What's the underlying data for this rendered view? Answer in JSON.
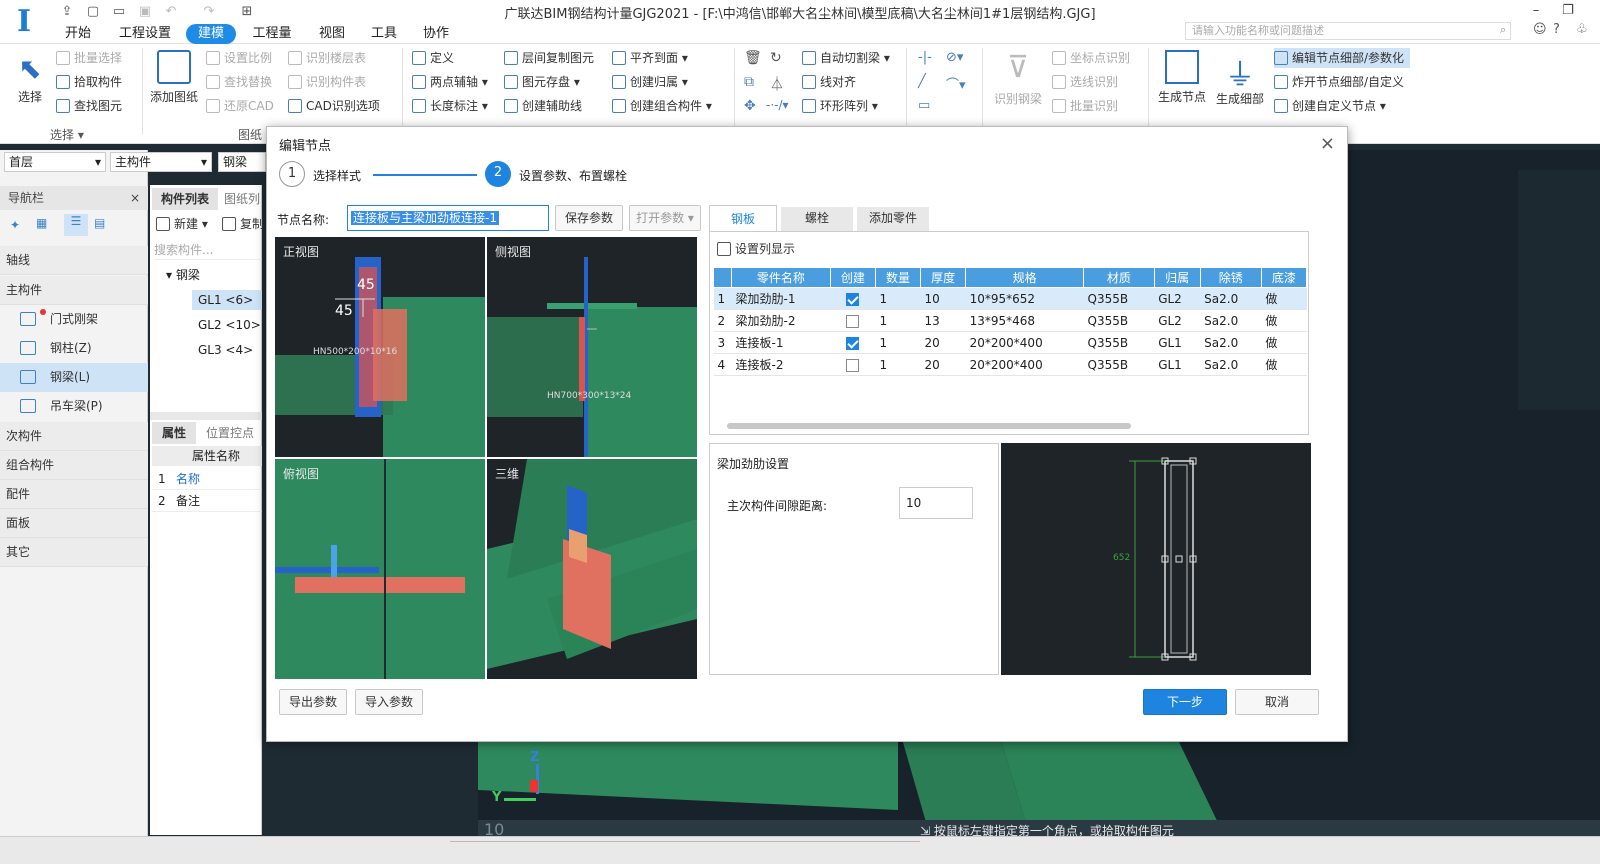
{
  "window": {
    "title": "广联达BIM钢结构计量GJG2021 - [F:\\中鸿信\\邯郸大名尘林间\\模型底稿\\大名尘林间1#1层钢结构.GJG]",
    "search_placeholder": "请输入功能名称或问题描述"
  },
  "menus": [
    "开始",
    "工程设置",
    "建模",
    "工程量",
    "视图",
    "工具",
    "协作"
  ],
  "ribbon": {
    "select_group": {
      "big": "选择",
      "items": [
        "批量选择",
        "拾取构件",
        "查找图元"
      ],
      "label": "选择"
    },
    "drawing_group": {
      "big": "添加图纸",
      "items": [
        "设置比例",
        "查找替换",
        "还原CAD",
        "识别楼层表",
        "识别构件表",
        "CAD识别选项"
      ],
      "label": "图纸"
    },
    "general": [
      "定义",
      "两点辅轴",
      "长度标注",
      "层间复制图元",
      "图元存盘",
      "创建辅助线",
      "平齐到面",
      "创建归属",
      "创建组合构件"
    ],
    "modify": [
      "自动切割梁",
      "线对齐",
      "环形阵列"
    ],
    "recognize": {
      "big": "识别钢梁",
      "items": [
        "坐标点识别",
        "选线识别",
        "批量识别"
      ]
    },
    "node": {
      "gen_node": "生成节点",
      "gen_detail": "生成细部",
      "items": [
        "编辑节点细部/参数化",
        "炸开节点细部/自定义",
        "创建自定义节点"
      ]
    }
  },
  "left": {
    "floor": "首层",
    "type": "主构件",
    "sub": "钢梁",
    "nav_title": "导航栏",
    "categories_top": [
      "轴线",
      "主构件"
    ],
    "items": [
      "门式刚架",
      "钢柱(Z)",
      "钢梁(L)",
      "吊车梁(P)"
    ],
    "categories_bottom": [
      "次构件",
      "组合构件",
      "配件",
      "面板",
      "其它"
    ]
  },
  "mid": {
    "tabs": [
      "构件列表",
      "图纸列"
    ],
    "new": "新建",
    "copy": "复制",
    "search": "搜索构件...",
    "tree_root": "钢梁",
    "tree": [
      "GL1 <6>",
      "GL2 <10>",
      "GL3 <4>"
    ],
    "prop_tabs": [
      "属性",
      "位置控点"
    ],
    "prop_header": "属性名称",
    "props": [
      {
        "no": "1",
        "name": "名称"
      },
      {
        "no": "2",
        "name": "备注"
      }
    ]
  },
  "dialog": {
    "title": "编辑节点",
    "steps": [
      {
        "no": "1",
        "label": "选择样式"
      },
      {
        "no": "2",
        "label": "设置参数、布置螺栓"
      }
    ],
    "name_label": "节点名称:",
    "name_value": "连接板与主梁加劲板连接-1",
    "save_btn": "保存参数",
    "open_btn": "打开参数",
    "views": {
      "front": "正视图",
      "side": "侧视图",
      "top": "俯视图",
      "iso": "三维"
    },
    "front_dims": [
      "45",
      "45"
    ],
    "front_section": "HN500*200*10*16",
    "side_section": "HN700*300*13*24",
    "tabs": [
      "钢板",
      "螺栓",
      "添加零件"
    ],
    "col_display": "设置列显示",
    "columns": [
      "",
      "零件名称",
      "创建",
      "数量",
      "厚度",
      "规格",
      "材质",
      "归属",
      "除锈",
      "底漆"
    ],
    "rows": [
      {
        "no": "1",
        "name": "梁加劲肋-1",
        "create": true,
        "qty": "1",
        "thk": "10",
        "spec": "10*95*652",
        "mat": "Q355B",
        "owner": "GL2",
        "rust": "Sa2.0",
        "paint": "做"
      },
      {
        "no": "2",
        "name": "梁加劲肋-2",
        "create": false,
        "qty": "1",
        "thk": "13",
        "spec": "13*95*468",
        "mat": "Q355B",
        "owner": "GL2",
        "rust": "Sa2.0",
        "paint": "做"
      },
      {
        "no": "3",
        "name": "连接板-1",
        "create": true,
        "qty": "1",
        "thk": "20",
        "spec": "20*200*400",
        "mat": "Q355B",
        "owner": "GL1",
        "rust": "Sa2.0",
        "paint": "做"
      },
      {
        "no": "4",
        "name": "连接板-2",
        "create": false,
        "qty": "1",
        "thk": "20",
        "spec": "20*200*400",
        "mat": "Q355B",
        "owner": "GL1",
        "rust": "Sa2.0",
        "paint": "做"
      }
    ],
    "settings_title": "梁加劲肋设置",
    "gap_label": "主次构件间隙距离:",
    "gap_value": "10",
    "preview_dim": "652",
    "export_btn": "导出参数",
    "import_btn": "导入参数",
    "next_btn": "下一步",
    "cancel_btn": "取消"
  },
  "viewport": {
    "z_label": "Z",
    "y_label": "Y",
    "layer_num": "10",
    "hint": "按鼠标左键指定第一个角点，或拾取构件图元"
  },
  "colors": {
    "accent": "#1e84e0",
    "dark_bg": "#1e2428",
    "green_member": "#2e8a5e",
    "red_plate": "#d9534f",
    "blue_part": "#2563c9"
  }
}
